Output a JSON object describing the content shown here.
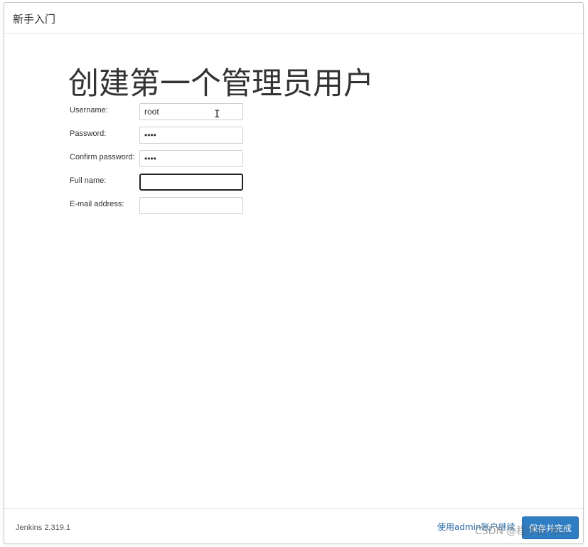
{
  "header": {
    "title": "新手入门"
  },
  "main": {
    "title": "创建第一个管理员用户",
    "fields": [
      {
        "label": "Username:",
        "value": "root",
        "type": "text"
      },
      {
        "label": "Password:",
        "value": "root",
        "type": "password"
      },
      {
        "label": "Confirm password:",
        "value": "root",
        "type": "password"
      },
      {
        "label": "Full name:",
        "value": "",
        "type": "text"
      },
      {
        "label": "E-mail address:",
        "value": "",
        "type": "text"
      }
    ]
  },
  "footer": {
    "version": "Jenkins 2.319.1",
    "continue_link": "使用admin账户继续",
    "save_button": "保存并完成"
  },
  "watermark": "CSDN @程序员-张三"
}
